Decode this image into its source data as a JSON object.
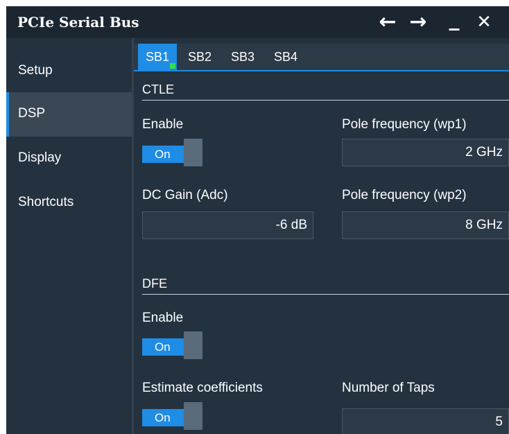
{
  "window": {
    "title": "PCIe Serial Bus"
  },
  "titlebar_buttons": [
    {
      "icon": "arrow-left-icon",
      "glyph": "←"
    },
    {
      "icon": "arrow-right-icon",
      "glyph": "→"
    },
    {
      "icon": "minimize-icon",
      "glyph": "_"
    },
    {
      "icon": "close-icon",
      "glyph": "✕"
    }
  ],
  "sidebar": {
    "items": [
      {
        "label": "Setup",
        "active": false
      },
      {
        "label": "DSP",
        "active": true
      },
      {
        "label": "Display",
        "active": false
      },
      {
        "label": "Shortcuts",
        "active": false
      }
    ]
  },
  "tabs": [
    {
      "label": "SB1",
      "active": true,
      "indicator_color": "#2ee04a"
    },
    {
      "label": "SB2",
      "active": false
    },
    {
      "label": "SB3",
      "active": false
    },
    {
      "label": "SB4",
      "active": false
    }
  ],
  "ctle": {
    "title": "CTLE",
    "enable_label": "Enable",
    "enable_state": "On",
    "pole1_label": "Pole frequency (wp1)",
    "pole1_value": "2 GHz",
    "dc_gain_label": "DC Gain (Adc)",
    "dc_gain_value": "-6 dB",
    "pole2_label": "Pole frequency (wp2)",
    "pole2_value": "8 GHz"
  },
  "dfe": {
    "title": "DFE",
    "enable_label": "Enable",
    "enable_state": "On",
    "estimate_label": "Estimate coefficients",
    "estimate_state": "On",
    "taps_label": "Number of Taps",
    "taps_value": "5"
  },
  "colors": {
    "accent": "#1f8ce5",
    "background": "#243240",
    "titlebar": "#1b2631",
    "active_indicator": "#2ee04a"
  }
}
